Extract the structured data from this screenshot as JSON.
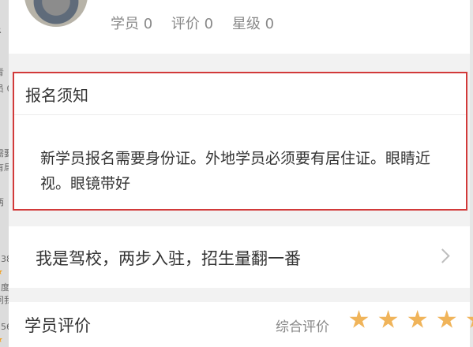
{
  "background_hints": {
    "left_edge_texts": [
      "R",
      "青",
      "员 0",
      "需要",
      "有局",
      "两",
      "138",
      "5度",
      "问我",
      "156"
    ]
  },
  "profile": {
    "students_label": "学员 0",
    "reviews_label": "评价 0",
    "rating_label": "星级 0"
  },
  "notice": {
    "title": "报名须知",
    "body": "新学员报名需要身份证。外地学员必须要有居住证。眼睛近视。眼镜带好"
  },
  "join": {
    "text": "我是驾校，两步入驻，招生量翻一番"
  },
  "reviews": {
    "title": "学员评价",
    "overall_label": "综合评价",
    "stars_filled": 5,
    "star_color": "#f0b45a"
  },
  "colors": {
    "highlight_border": "#d23a3a",
    "background": "#f2f2f2"
  }
}
